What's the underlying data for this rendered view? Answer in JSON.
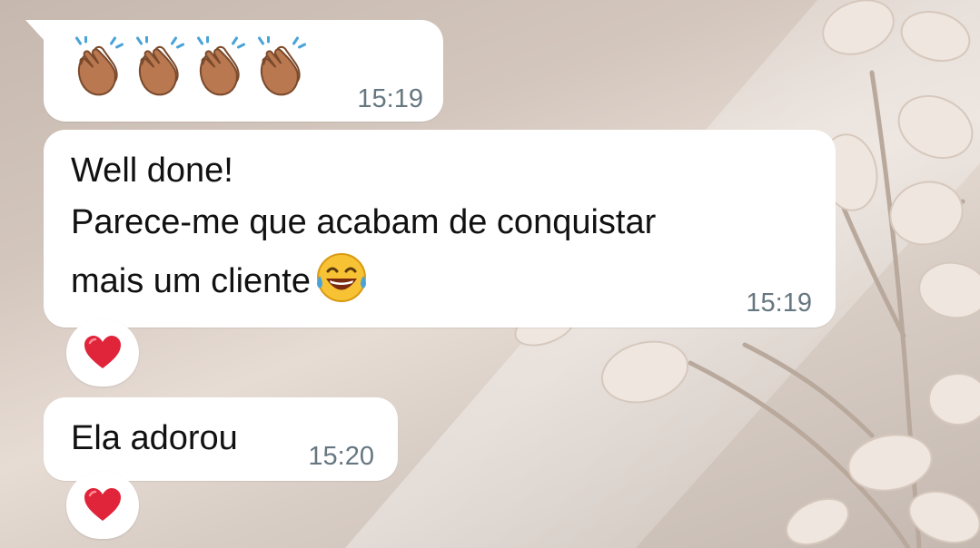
{
  "chat": {
    "messages": [
      {
        "type": "emoji",
        "emoji_icons": [
          "clapping-hands-icon",
          "clapping-hands-icon",
          "clapping-hands-icon",
          "clapping-hands-icon"
        ],
        "time": "15:19"
      },
      {
        "type": "text",
        "lines": [
          "Well done!",
          "Parece-me que acabam de conquistar",
          "mais um cliente"
        ],
        "trailing_emoji": "laughing-tears-icon",
        "time": "15:19",
        "reaction": "red-heart-icon"
      },
      {
        "type": "text",
        "lines": [
          "Ela adorou"
        ],
        "time": "15:20",
        "reaction": "red-heart-icon"
      }
    ]
  },
  "colors": {
    "bubble": "#ffffff",
    "text": "#111111",
    "timestamp": "#667781",
    "heart": "#e0243a",
    "wallpaper": "#d8cbc2"
  }
}
